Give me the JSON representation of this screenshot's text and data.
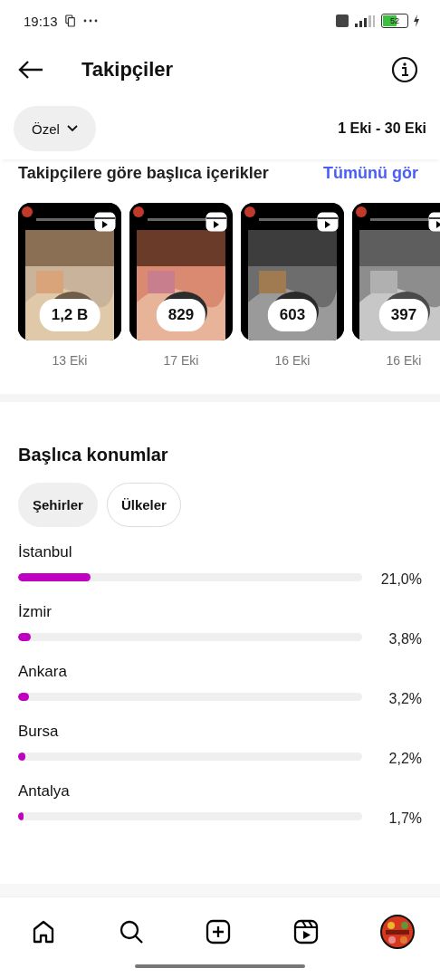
{
  "status_bar": {
    "time": "19:13",
    "battery": "52"
  },
  "header": {
    "title": "Takipçiler"
  },
  "filter": {
    "label": "Özel",
    "date_range": "1 Eki - 30 Eki"
  },
  "top_content": {
    "title": "Takipçilere göre başlıca içerikler",
    "link": "Tümünü gör",
    "items": [
      {
        "kind": "picture",
        "count": "1,2 B",
        "date": "13 Eki"
      },
      {
        "kind": "picture",
        "count": "829",
        "date": "17 Eki"
      },
      {
        "kind": "picture",
        "count": "603",
        "date": "16 Eki"
      },
      {
        "kind": "picture",
        "count": "397",
        "date": "16 Eki"
      }
    ]
  },
  "locations": {
    "title": "Başlıca konumlar",
    "tabs": [
      {
        "label": "Şehirler",
        "selected": true
      },
      {
        "label": "Ülkeler",
        "selected": false
      }
    ],
    "rows": [
      {
        "name": "İstanbul",
        "level": 0.21,
        "reading": "21,0%"
      },
      {
        "name": "İzmir",
        "level": 0.038,
        "reading": "3,8%"
      },
      {
        "name": "Ankara",
        "level": 0.032,
        "reading": "3,2%"
      },
      {
        "name": "Bursa",
        "level": 0.022,
        "reading": "2,2%"
      },
      {
        "name": "Antalya",
        "level": 0.017,
        "reading": "1,7%"
      }
    ]
  },
  "nav": [
    {
      "kind": "home"
    },
    {
      "kind": "search"
    },
    {
      "kind": "create"
    },
    {
      "kind": "reels"
    },
    {
      "kind": "profile"
    }
  ]
}
